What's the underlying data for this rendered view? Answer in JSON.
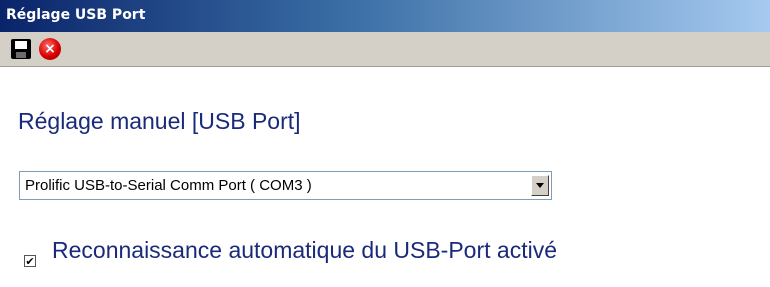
{
  "window": {
    "title": "Réglage USB Port"
  },
  "toolbar": {
    "save_icon": "floppy-disk-icon",
    "cancel_icon": "stop-icon"
  },
  "main": {
    "heading": "Réglage manuel [USB Port]",
    "port_select": {
      "value": "Prolific USB-to-Serial Comm Port ( COM3 )"
    },
    "auto_detect": {
      "checked": true,
      "label": "Reconnaissance automatique du USB-Port activé"
    }
  }
}
